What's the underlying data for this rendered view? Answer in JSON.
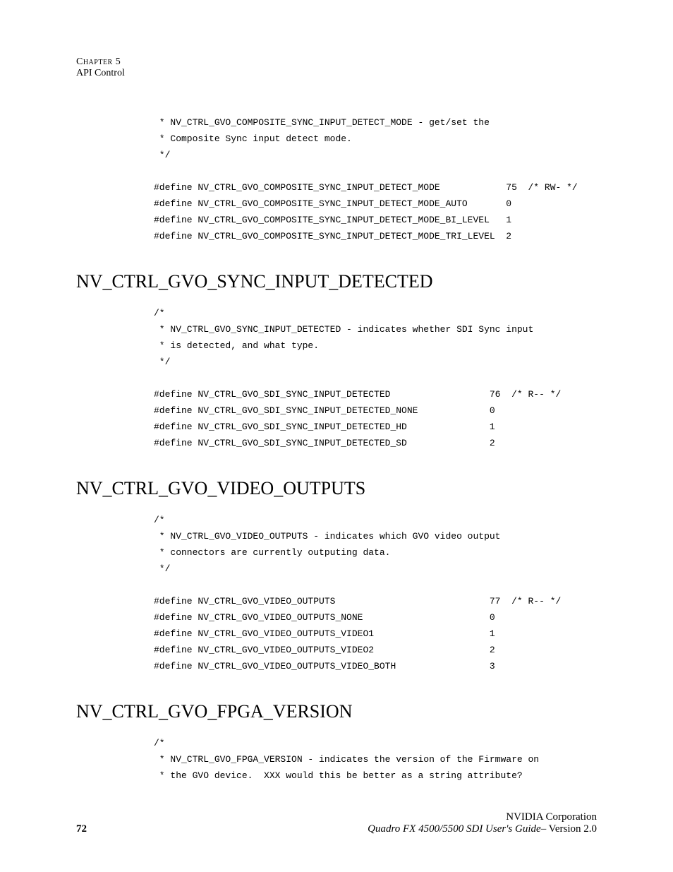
{
  "header": {
    "chapter": "Chapter 5",
    "title": "API Control"
  },
  "sections": [
    {
      "code": " * NV_CTRL_GVO_COMPOSITE_SYNC_INPUT_DETECT_MODE - get/set the\n * Composite Sync input detect mode.\n */\n\n#define NV_CTRL_GVO_COMPOSITE_SYNC_INPUT_DETECT_MODE            75  /* RW- */\n#define NV_CTRL_GVO_COMPOSITE_SYNC_INPUT_DETECT_MODE_AUTO       0\n#define NV_CTRL_GVO_COMPOSITE_SYNC_INPUT_DETECT_MODE_BI_LEVEL   1\n#define NV_CTRL_GVO_COMPOSITE_SYNC_INPUT_DETECT_MODE_TRI_LEVEL  2"
    },
    {
      "heading": "NV_CTRL_GVO_SYNC_INPUT_DETECTED",
      "code": "/*\n * NV_CTRL_GVO_SYNC_INPUT_DETECTED - indicates whether SDI Sync input\n * is detected, and what type.\n */\n\n#define NV_CTRL_GVO_SDI_SYNC_INPUT_DETECTED                  76  /* R-- */\n#define NV_CTRL_GVO_SDI_SYNC_INPUT_DETECTED_NONE             0\n#define NV_CTRL_GVO_SDI_SYNC_INPUT_DETECTED_HD               1\n#define NV_CTRL_GVO_SDI_SYNC_INPUT_DETECTED_SD               2"
    },
    {
      "heading": "NV_CTRL_GVO_VIDEO_OUTPUTS",
      "code": "/*\n * NV_CTRL_GVO_VIDEO_OUTPUTS - indicates which GVO video output\n * connectors are currently outputing data.\n */\n\n#define NV_CTRL_GVO_VIDEO_OUTPUTS                            77  /* R-- */\n#define NV_CTRL_GVO_VIDEO_OUTPUTS_NONE                       0\n#define NV_CTRL_GVO_VIDEO_OUTPUTS_VIDEO1                     1\n#define NV_CTRL_GVO_VIDEO_OUTPUTS_VIDEO2                     2\n#define NV_CTRL_GVO_VIDEO_OUTPUTS_VIDEO_BOTH                 3"
    },
    {
      "heading": "NV_CTRL_GVO_FPGA_VERSION",
      "code": "/*\n * NV_CTRL_GVO_FPGA_VERSION - indicates the version of the Firmware on\n * the GVO device.  XXX would this be better as a string attribute?"
    }
  ],
  "footer": {
    "page": "72",
    "company": "NVIDIA Corporation",
    "guide": "Quadro FX 4500/5500 SDI User's Guide",
    "version": "– Version 2.0"
  }
}
